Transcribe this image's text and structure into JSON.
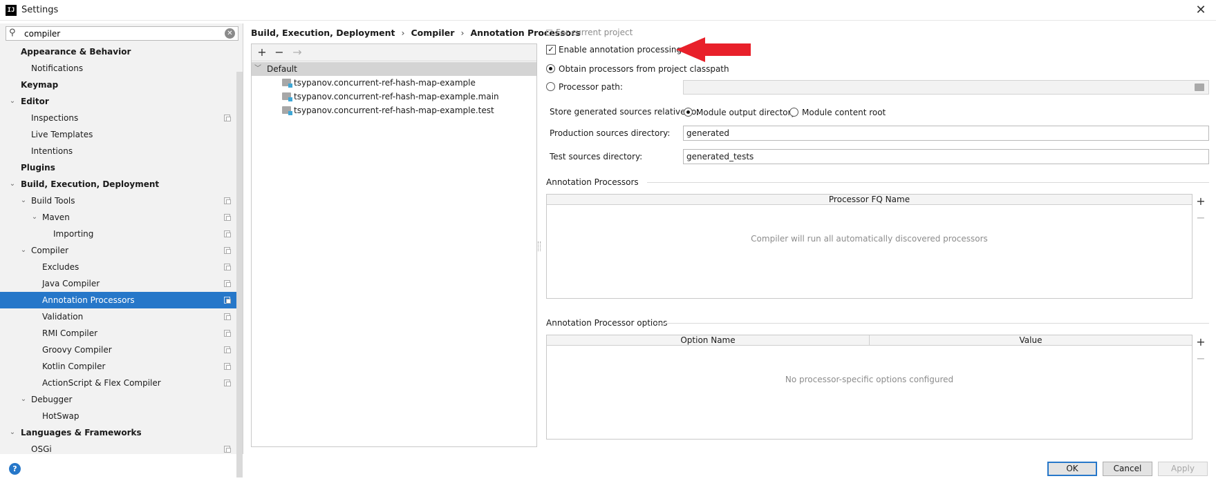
{
  "window": {
    "title": "Settings",
    "icon": "IJ"
  },
  "search": {
    "value": "compiler"
  },
  "sidebar": {
    "items": [
      {
        "label": "Appearance & Behavior",
        "bold": true,
        "level": 0,
        "expanded": null,
        "copy": false
      },
      {
        "label": "Notifications",
        "bold": false,
        "level": 1,
        "expanded": null,
        "copy": false
      },
      {
        "label": "Keymap",
        "bold": true,
        "level": 0,
        "expanded": null,
        "copy": false
      },
      {
        "label": "Editor",
        "bold": true,
        "level": 0,
        "expanded": true,
        "copy": false
      },
      {
        "label": "Inspections",
        "bold": false,
        "level": 1,
        "expanded": null,
        "copy": true
      },
      {
        "label": "Live Templates",
        "bold": false,
        "level": 1,
        "expanded": null,
        "copy": false
      },
      {
        "label": "Intentions",
        "bold": false,
        "level": 1,
        "expanded": null,
        "copy": false
      },
      {
        "label": "Plugins",
        "bold": true,
        "level": 0,
        "expanded": null,
        "copy": false
      },
      {
        "label": "Build, Execution, Deployment",
        "bold": true,
        "level": 0,
        "expanded": true,
        "copy": false
      },
      {
        "label": "Build Tools",
        "bold": false,
        "level": 1,
        "expanded": true,
        "copy": true
      },
      {
        "label": "Maven",
        "bold": false,
        "level": 2,
        "expanded": true,
        "copy": true
      },
      {
        "label": "Importing",
        "bold": false,
        "level": 3,
        "expanded": null,
        "copy": true
      },
      {
        "label": "Compiler",
        "bold": false,
        "level": 1,
        "expanded": true,
        "copy": true
      },
      {
        "label": "Excludes",
        "bold": false,
        "level": 2,
        "expanded": null,
        "copy": true
      },
      {
        "label": "Java Compiler",
        "bold": false,
        "level": 2,
        "expanded": null,
        "copy": true
      },
      {
        "label": "Annotation Processors",
        "bold": false,
        "level": 2,
        "expanded": null,
        "copy": true,
        "selected": true
      },
      {
        "label": "Validation",
        "bold": false,
        "level": 2,
        "expanded": null,
        "copy": true
      },
      {
        "label": "RMI Compiler",
        "bold": false,
        "level": 2,
        "expanded": null,
        "copy": true
      },
      {
        "label": "Groovy Compiler",
        "bold": false,
        "level": 2,
        "expanded": null,
        "copy": true
      },
      {
        "label": "Kotlin Compiler",
        "bold": false,
        "level": 2,
        "expanded": null,
        "copy": true
      },
      {
        "label": "ActionScript & Flex Compiler",
        "bold": false,
        "level": 2,
        "expanded": null,
        "copy": true
      },
      {
        "label": "Debugger",
        "bold": false,
        "level": 1,
        "expanded": true,
        "copy": false
      },
      {
        "label": "HotSwap",
        "bold": false,
        "level": 2,
        "expanded": null,
        "copy": false
      },
      {
        "label": "Languages & Frameworks",
        "bold": true,
        "level": 0,
        "expanded": true,
        "copy": false
      },
      {
        "label": "OSGi",
        "bold": false,
        "level": 1,
        "expanded": null,
        "copy": true
      }
    ]
  },
  "breadcrumb": [
    "Build, Execution, Deployment",
    "Compiler",
    "Annotation Processors"
  ],
  "profiles": {
    "toolbar": {
      "add": "+",
      "remove": "−",
      "move": "→"
    },
    "default_label": "Default",
    "modules": [
      "tsypanov.concurrent-ref-hash-map-example",
      "tsypanov.concurrent-ref-hash-map-example.main",
      "tsypanov.concurrent-ref-hash-map-example.test"
    ]
  },
  "settings": {
    "for_current_project": "For current project",
    "enable_label": "Enable annotation processing",
    "enable_checked": true,
    "obtain_label": "Obtain processors from project classpath",
    "processor_path_label": "Processor path:",
    "store_label": "Store generated sources relative to:",
    "module_output_label": "Module output directory",
    "module_content_label": "Module content root",
    "production_label": "Production sources directory:",
    "production_value": "generated",
    "test_label": "Test sources directory:",
    "test_value": "generated_tests"
  },
  "annotation_processors": {
    "title": "Annotation Processors",
    "column": "Processor FQ Name",
    "empty": "Compiler will run all automatically discovered processors"
  },
  "processor_options": {
    "title": "Annotation Processor options",
    "columns": [
      "Option Name",
      "Value"
    ],
    "empty": "No processor-specific options configured"
  },
  "buttons": {
    "ok": "OK",
    "cancel": "Cancel",
    "apply": "Apply"
  },
  "colors": {
    "selection": "#2677c9",
    "arrow": "#e8202a"
  }
}
